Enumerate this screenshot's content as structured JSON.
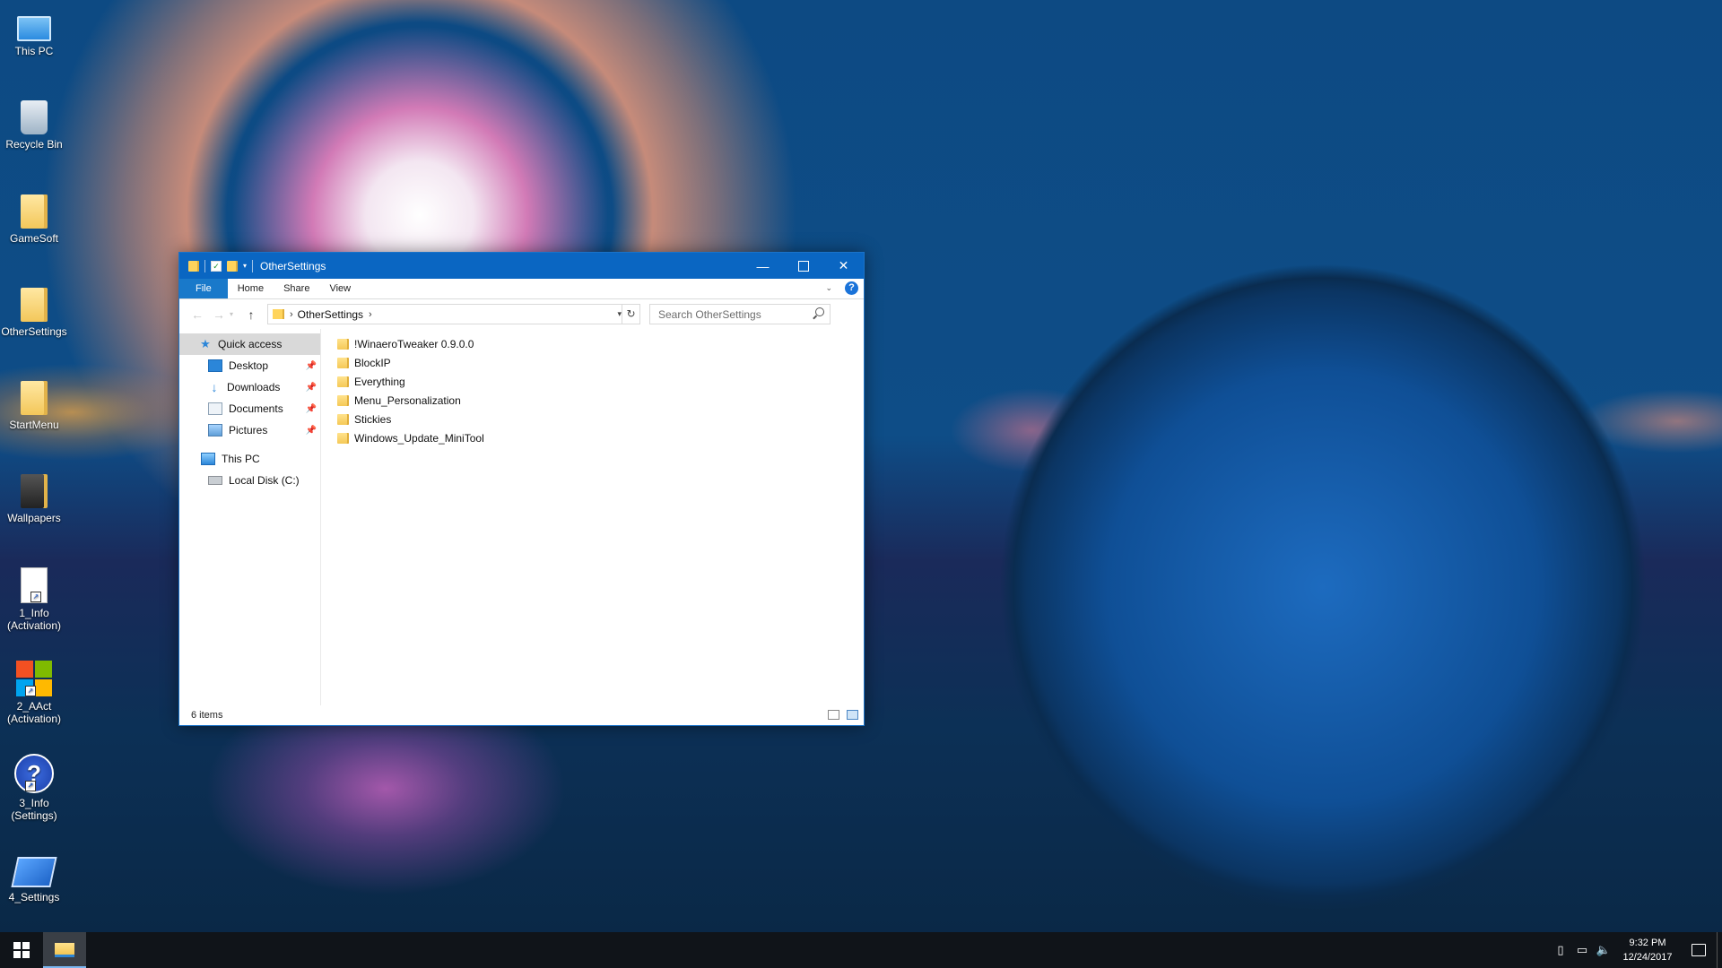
{
  "desktop": {
    "icons": [
      {
        "label": "This PC",
        "shortcut": false
      },
      {
        "label": "Recycle Bin",
        "shortcut": false
      },
      {
        "label": "GameSoft",
        "shortcut": false
      },
      {
        "label": "OtherSettings",
        "shortcut": false
      },
      {
        "label": "StartMenu",
        "shortcut": false
      },
      {
        "label": "Wallpapers",
        "shortcut": false
      },
      {
        "label": "1_Info (Activation)",
        "shortcut": true
      },
      {
        "label": "2_AAct (Activation)",
        "shortcut": true
      },
      {
        "label": "3_Info (Settings)",
        "shortcut": true
      },
      {
        "label": "4_Settings",
        "shortcut": true
      }
    ]
  },
  "window": {
    "title": "OtherSettings",
    "ribbon_tabs": [
      "File",
      "Home",
      "Share",
      "View"
    ],
    "help_label": "?",
    "address": {
      "crumbs": [
        "OtherSettings"
      ]
    },
    "search": {
      "placeholder": "Search OtherSettings"
    },
    "nav_pane": {
      "quick_access": "Quick access",
      "pinned": [
        "Desktop",
        "Downloads",
        "Documents",
        "Pictures"
      ],
      "this_pc": "This PC",
      "local_disk": "Local Disk (C:)"
    },
    "items": [
      "!WinaeroTweaker 0.9.0.0",
      "BlockIP",
      "Everything",
      "Menu_Personalization",
      "Stickies",
      "Windows_Update_MiniTool"
    ],
    "status": "6 items"
  },
  "taskbar": {
    "clock": {
      "time": "9:32 PM",
      "date": "12/24/2017"
    }
  },
  "colors": {
    "titlebar": "#0a66c2",
    "file_tab": "#1979ca",
    "taskbar": "#101419",
    "folder": "#f5c957"
  },
  "icons": {
    "pin": "pin-icon",
    "star": "star-icon",
    "search": "search-icon"
  }
}
